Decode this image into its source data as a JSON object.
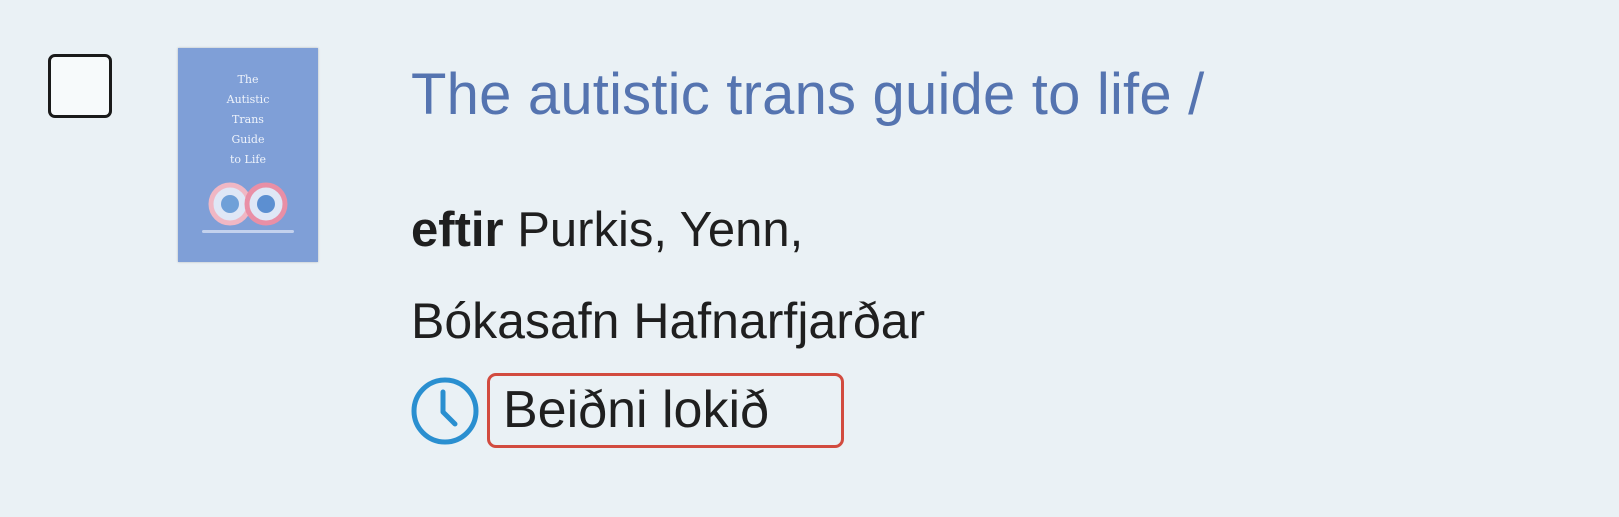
{
  "record": {
    "title": "The autistic trans guide to life /",
    "author_prefix": "eftir",
    "author_name": "Purkis, Yenn,",
    "library": "Bókasafn Hafnarfjarðar",
    "status": "Beiðni lokið",
    "status_icon": "clock-icon",
    "cover": {
      "lines": [
        "The",
        "Autistic",
        "Trans",
        "Guide",
        "to Life"
      ],
      "color": "#7f9fd7"
    }
  },
  "checkbox": {
    "checked": false
  },
  "colors": {
    "title_link": "#5574b0",
    "status_icon": "#2a8fd0",
    "highlight_border": "#d24b3f",
    "background": "#eaf1f5"
  }
}
